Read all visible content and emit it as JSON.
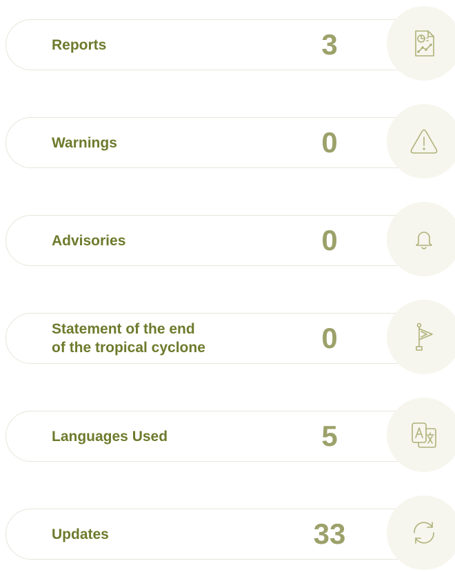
{
  "stats": [
    {
      "label": "Reports",
      "value": "3",
      "icon": "report-chart-icon"
    },
    {
      "label": "Warnings",
      "value": "0",
      "icon": "warning-icon"
    },
    {
      "label": "Advisories",
      "value": "0",
      "icon": "bell-icon"
    },
    {
      "label": "Statement of the end\nof the tropical cyclone",
      "value": "0",
      "icon": "flag-icon"
    },
    {
      "label": "Languages Used",
      "value": "5",
      "icon": "translate-icon"
    },
    {
      "label": "Updates",
      "value": "33",
      "icon": "refresh-icon"
    }
  ],
  "colors": {
    "label": "#6e7a2c",
    "value": "#9ca16a",
    "icon": "#aeb178",
    "badge_bg": "#f6f6ee",
    "border": "#e6e6dc"
  }
}
